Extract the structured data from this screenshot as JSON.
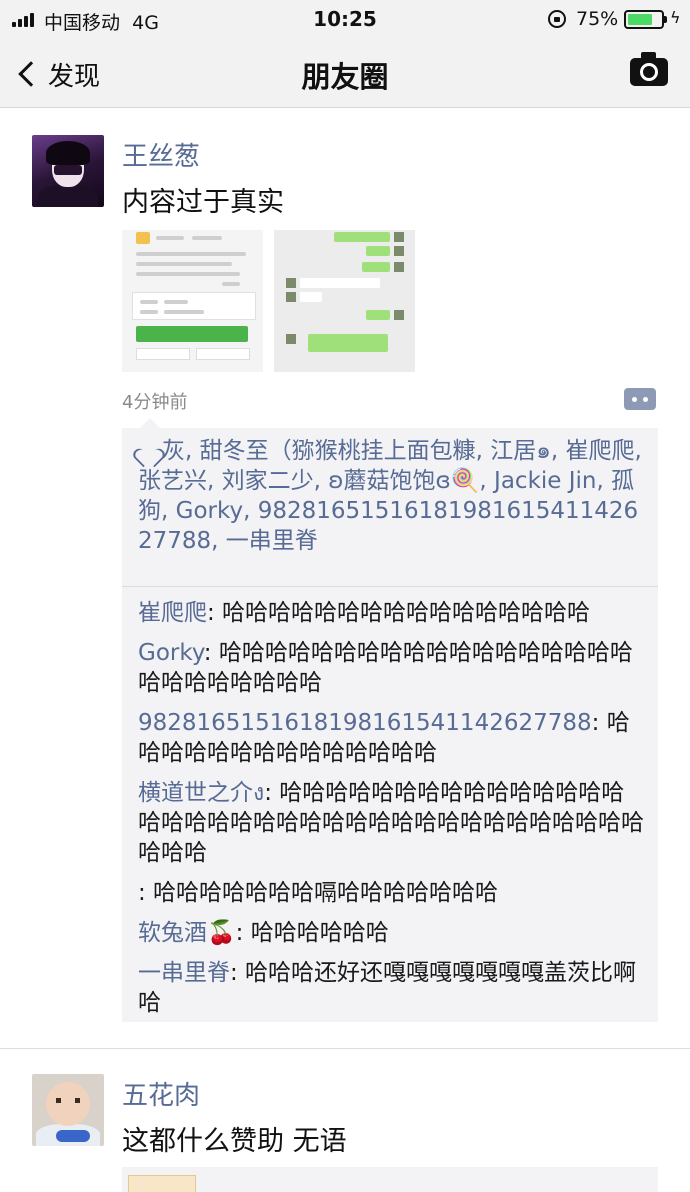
{
  "status_bar": {
    "carrier": "中国移动",
    "network": "4G",
    "time": "10:25",
    "battery": "75%",
    "battery_level": 0.75,
    "icons": [
      "signal-icon",
      "orientation-lock-icon",
      "battery-icon",
      "charging-icon"
    ]
  },
  "nav": {
    "back_label": "发现",
    "title": "朋友圈",
    "icons": [
      "chevron-left-icon",
      "camera-icon"
    ]
  },
  "posts": [
    {
      "author": "王丝葱",
      "text": "内容过于真实",
      "time": "4分钟前",
      "likes": "灰, 甜冬至（猕猴桃挂上面包糠, 江居๑, 崔爬爬, 张艺兴, 刘家二少, ʚ蘑菇饱饱ɞ🍭, Jackie Jin, 孤狗, Gorky, 9828165151618198161541142627788, 一串里脊",
      "comments": [
        {
          "name": "崔爬爬",
          "text": ": 哈哈哈哈哈哈哈哈哈哈哈哈哈哈哈哈"
        },
        {
          "name": "Gorky",
          "text": ": 哈哈哈哈哈哈哈哈哈哈哈哈哈哈哈哈哈哈哈哈哈哈哈哈哈哈"
        },
        {
          "name": "9828165151618198161541142627788",
          "text": ": 哈哈哈哈哈哈哈哈哈哈哈哈哈哈"
        },
        {
          "name": "横道世之介ง",
          "text": ": 哈哈哈哈哈哈哈哈哈哈哈哈哈哈哈哈哈哈哈哈哈哈哈哈哈哈哈哈哈哈哈哈哈哈哈哈哈哈哈哈"
        },
        {
          "name": "",
          "text": ": 哈哈哈哈哈哈哈嗝哈哈哈哈哈哈哈"
        },
        {
          "name": "软兔酒🍒",
          "text": ": 哈哈哈哈哈哈"
        },
        {
          "name": "一串里脊",
          "text": ": 哈哈哈还好还嘎嘎嘎嘎嘎嘎嘎盖茨比啊哈"
        }
      ]
    },
    {
      "author": "五花肉",
      "text": "这都什么赞助 无语"
    }
  ],
  "colors": {
    "link_blue": "#576b95",
    "bar_bg": "#f2f2f2",
    "comment_bg": "#f3f3f5",
    "battery_green": "#4cd964"
  }
}
